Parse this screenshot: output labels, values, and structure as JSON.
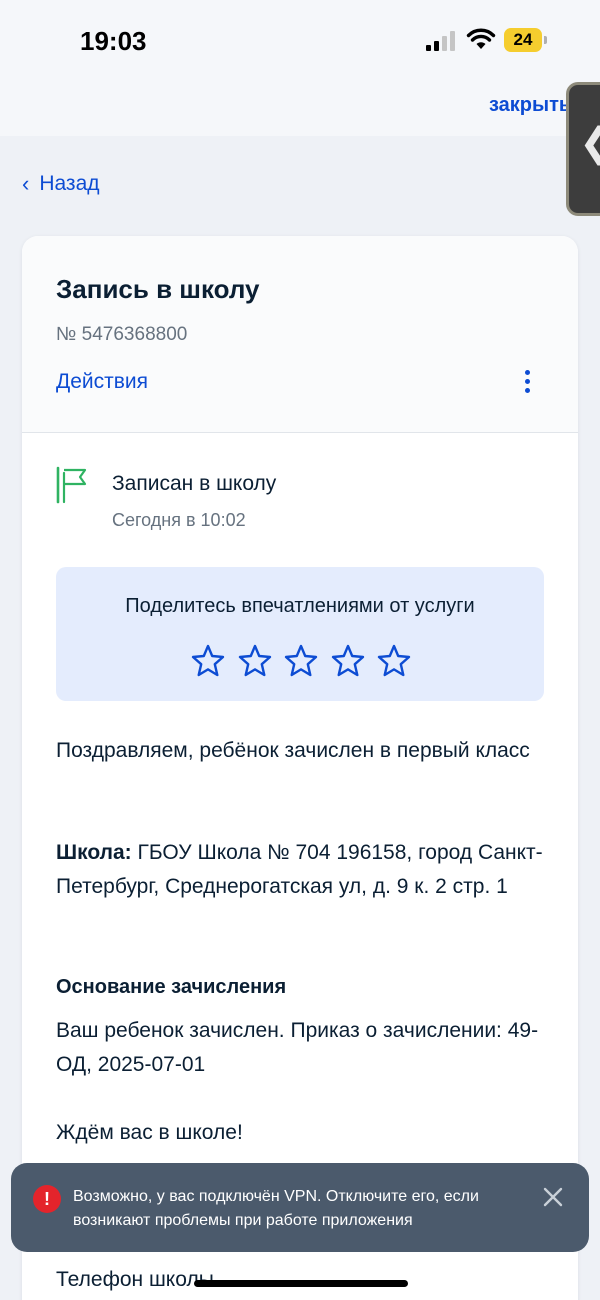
{
  "status_bar": {
    "time": "19:03",
    "battery": "24"
  },
  "header": {
    "close_label": "закрыть"
  },
  "nav": {
    "back_label": "Назад"
  },
  "card": {
    "title": "Запись в школу",
    "number": "№ 5476368800",
    "actions_label": "Действия"
  },
  "status": {
    "label": "Записан в школу",
    "time": "Сегодня в 10:02"
  },
  "rating": {
    "prompt": "Поделитесь впечатлениями от услуги",
    "stars_total": 5,
    "stars_filled": 0
  },
  "content": {
    "congrats": "Поздравляем, ребёнок зачислен в первый класс",
    "school_label": "Школа:",
    "school_value": " ГБОУ Школа № 704 196158, город Санкт-Петербург, Среднерогатская ул, д. 9 к. 2 стр. 1",
    "basis_title": "Основание зачисления",
    "basis_text": "Ваш ребенок зачислен. Приказ о зачислении: 49-ОД, 2025-07-01",
    "waiting": "Ждём вас в школе!",
    "phone_label": "Телефон школы"
  },
  "toast": {
    "text": "Возможно, у вас подключён VPN. Отключите его, если возникают проблемы при работе приложения",
    "icon": "alert-icon",
    "close_icon": "close-icon"
  },
  "colors": {
    "accent": "#0d4cd3",
    "flag": "#2fb362",
    "toast_bg": "#4b5a6c",
    "alert": "#e4242b"
  }
}
